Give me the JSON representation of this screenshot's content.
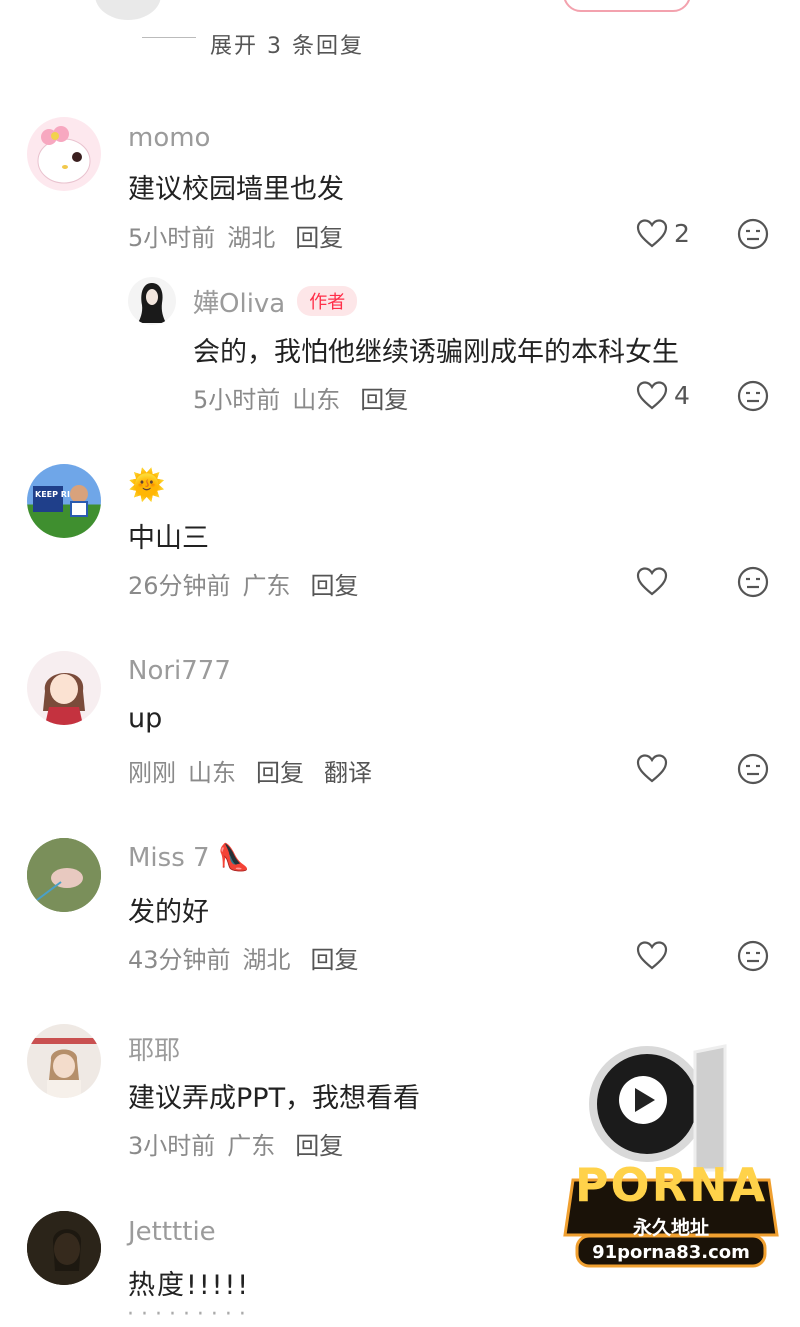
{
  "top": {
    "expand_text": "展开 3 条回复"
  },
  "comments": [
    {
      "user": "momo",
      "text": "建议校园墙里也发",
      "time": "5小时前",
      "location": "湖北",
      "reply": "回复",
      "likes": "2"
    },
    {
      "user": "嬅Oliva",
      "badge": "作者",
      "text": "会的，我怕他继续诱骗刚成年的本科女生",
      "time": "5小时前",
      "location": "山东",
      "reply": "回复",
      "likes": "4"
    },
    {
      "user": "🌞",
      "text": "中山三",
      "time": "26分钟前",
      "location": "广东",
      "reply": "回复",
      "likes": ""
    },
    {
      "user": "Nori777",
      "text": "up",
      "time": "刚刚",
      "location": "山东",
      "reply": "回复",
      "translate": "翻译",
      "likes": ""
    },
    {
      "user": "Miss 7 👠",
      "text": "发的好",
      "time": "43分钟前",
      "location": "湖北",
      "reply": "回复",
      "likes": ""
    },
    {
      "user": "耶耶",
      "text": "建议弄成PPT，我想看看",
      "time": "3小时前",
      "location": "广东",
      "reply": "回复",
      "likes": ""
    },
    {
      "user": "Jettttie",
      "text": "热度!!!!!",
      "time": "",
      "location": "",
      "reply": "",
      "likes": ""
    }
  ],
  "avatar_text": {
    "keep_rich": "KEEP RICH"
  },
  "watermark": {
    "number": "91",
    "brand": "PORNA",
    "slogan": "永久地址",
    "url": "91porna83.com"
  },
  "colors": {
    "accent": "#ff2f49",
    "badge_bg": "#fde6e8",
    "meta": "#8a8a8a",
    "username": "#9b9b9b"
  }
}
